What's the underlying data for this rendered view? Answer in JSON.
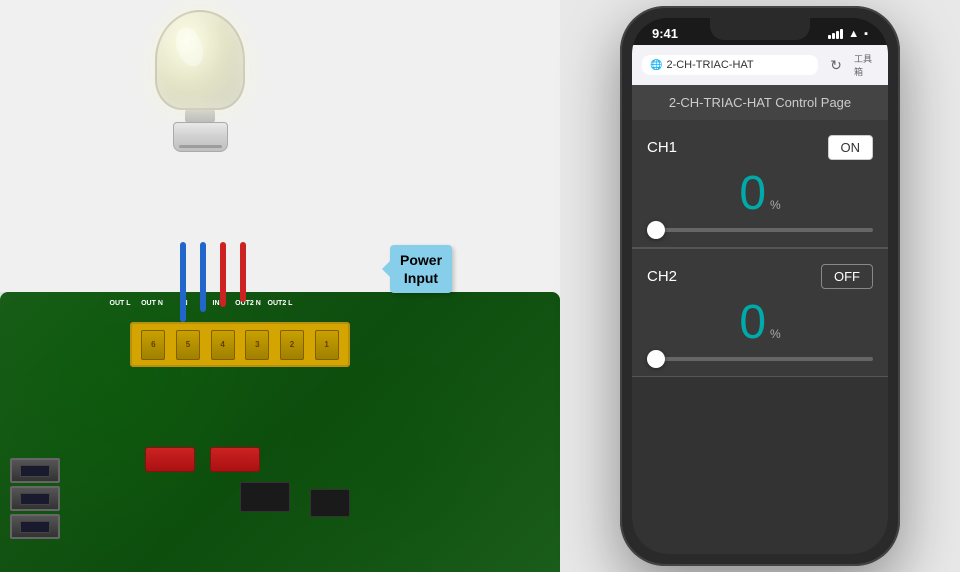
{
  "hardware": {
    "power_input_label": "Power\nInput",
    "power_input_line1": "Power",
    "power_input_line2": "Input",
    "terminal_labels": [
      "OUT L",
      "OUT N",
      "IN",
      "IN",
      "OUT2 N",
      "OUT2 L"
    ],
    "terminal_screws": [
      "6",
      "5",
      "4",
      "3",
      "2",
      "1"
    ]
  },
  "phone": {
    "status_bar": {
      "time": "9:41",
      "signal": "●●●●",
      "wifi": "wifi",
      "battery": "batt"
    },
    "browser": {
      "url": "2-CH-TRIAC-HAT",
      "refresh_icon": "↻",
      "tools_icon": "工具箱"
    },
    "page": {
      "title": "2-CH-TRIAC-HAT Control Page",
      "ch1": {
        "label": "CH1",
        "toggle": "ON",
        "value": "0",
        "unit": "%",
        "slider_value": 0
      },
      "ch2": {
        "label": "CH2",
        "toggle": "OFF",
        "value": "0",
        "unit": "%",
        "slider_value": 0
      }
    },
    "accent_color": "#00aaaa"
  }
}
